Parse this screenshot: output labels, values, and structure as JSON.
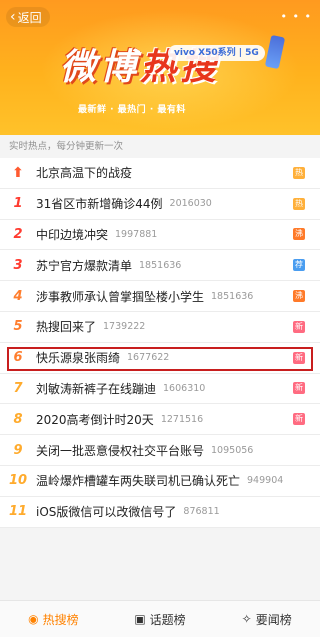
{
  "banner": {
    "back_label": "返回",
    "title_part1": "微博",
    "title_part2": "热搜",
    "ad_tag": "vivo X50系列 | 5G",
    "tagline": "最新鲜 · 最热门 · 最有料",
    "more_dots": "• • •"
  },
  "subheader": "实时热点，每分钟更新一次",
  "hot_list": [
    {
      "rank": "",
      "title": "北京高温下的战疫",
      "count": "",
      "badge": "热",
      "badge_type": "hot"
    },
    {
      "rank": "1",
      "title": "31省区市新增确诊44例",
      "count": "2016030",
      "badge": "热",
      "badge_type": "hot"
    },
    {
      "rank": "2",
      "title": "中印边境冲突",
      "count": "1997881",
      "badge": "沸",
      "badge_type": "boil"
    },
    {
      "rank": "3",
      "title": "苏宁官方爆款清单",
      "count": "1851636",
      "badge": "荐",
      "badge_type": "rec"
    },
    {
      "rank": "4",
      "title": "涉事教师承认曾掌掴坠楼小学生",
      "count": "1851636",
      "badge": "沸",
      "badge_type": "boil"
    },
    {
      "rank": "5",
      "title": "热搜回来了",
      "count": "1739222",
      "badge": "新",
      "badge_type": "new"
    },
    {
      "rank": "6",
      "title": "快乐源泉张雨绮",
      "count": "1677622",
      "badge": "新",
      "badge_type": "new"
    },
    {
      "rank": "7",
      "title": "刘敏涛新裤子在线蹦迪",
      "count": "1606310",
      "badge": "新",
      "badge_type": "new"
    },
    {
      "rank": "8",
      "title": "2020高考倒计时20天",
      "count": "1271516",
      "badge": "新",
      "badge_type": "new"
    },
    {
      "rank": "9",
      "title": "关闭一批恶意侵权社交平台账号",
      "count": "1095056",
      "badge": "",
      "badge_type": ""
    },
    {
      "rank": "10",
      "title": "温岭爆炸槽罐车两失联司机已确认死亡",
      "count": "949904",
      "badge": "",
      "badge_type": ""
    },
    {
      "rank": "11",
      "title": "iOS版微信可以改微信号了",
      "count": "876811",
      "badge": "",
      "badge_type": ""
    }
  ],
  "tabbar": {
    "tabs": [
      {
        "label": "热搜榜",
        "icon": "fire-icon",
        "active": true
      },
      {
        "label": "话题榜",
        "icon": "topic-icon",
        "active": false
      },
      {
        "label": "要闻榜",
        "icon": "news-icon",
        "active": false
      }
    ]
  },
  "colors": {
    "accent": "#ff8200",
    "highlight_border": "#c81e1e"
  }
}
